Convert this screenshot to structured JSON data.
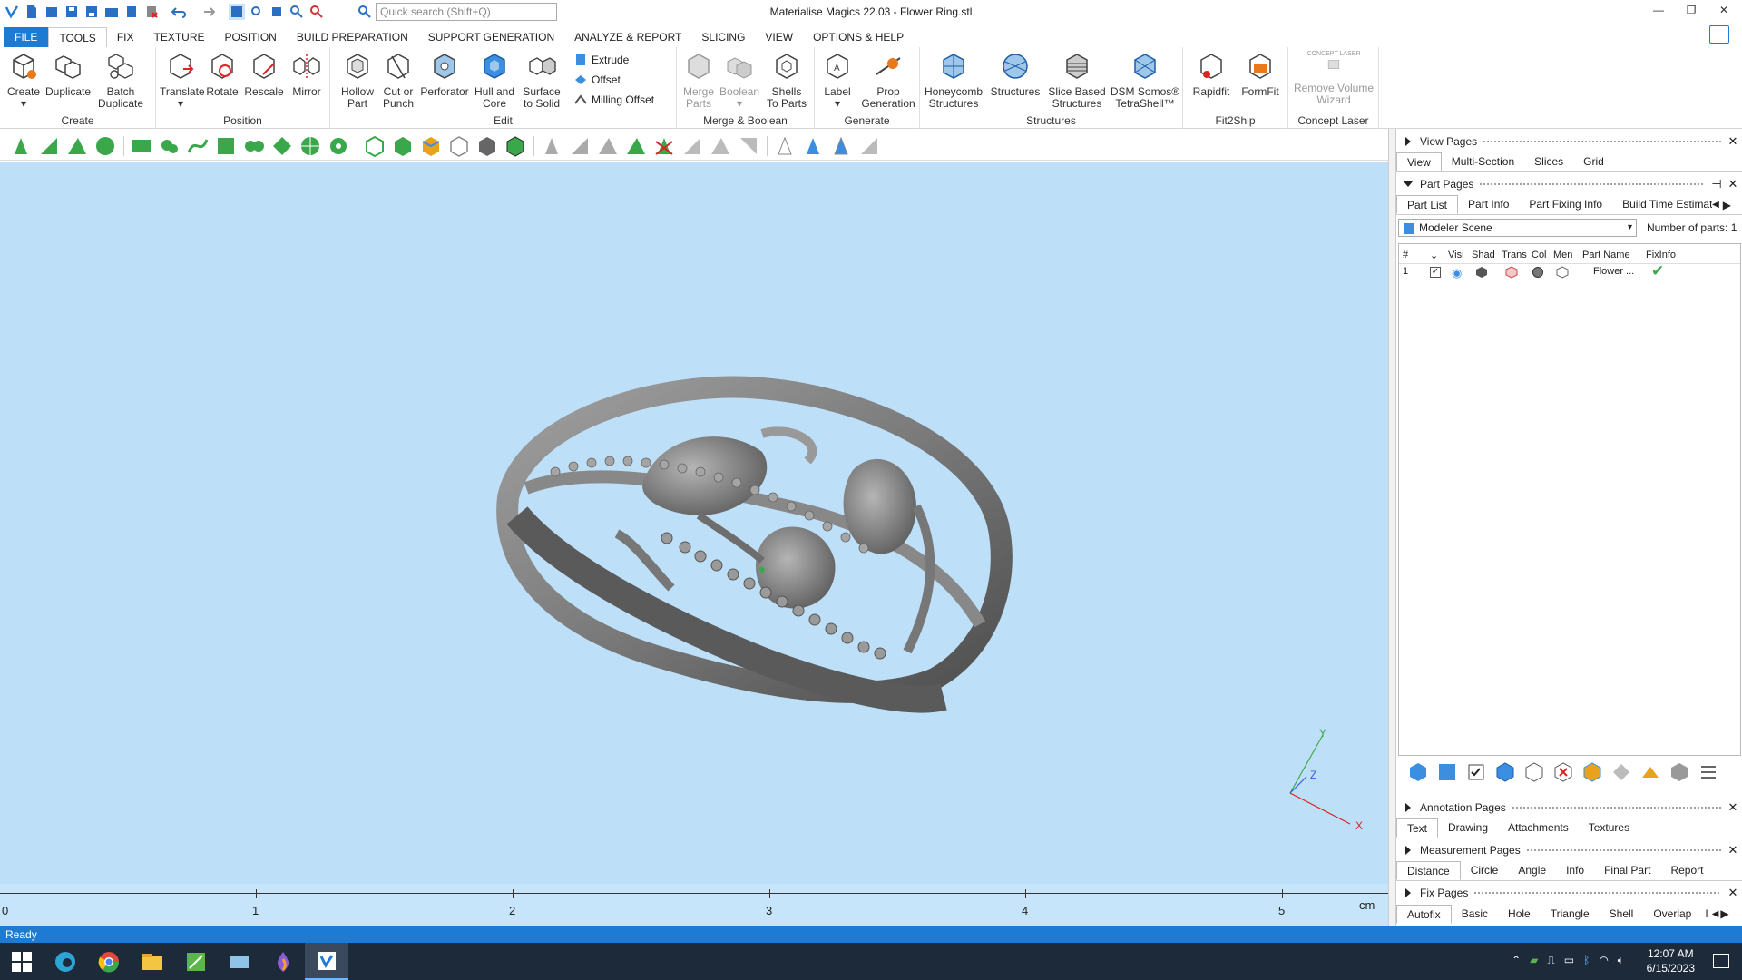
{
  "window": {
    "title": "Materialise Magics 22.03 - Flower Ring.stl",
    "search_placeholder": "Quick search (Shift+Q)"
  },
  "menu_tabs": [
    "FILE",
    "TOOLS",
    "FIX",
    "TEXTURE",
    "POSITION",
    "BUILD PREPARATION",
    "SUPPORT GENERATION",
    "ANALYZE & REPORT",
    "SLICING",
    "VIEW",
    "OPTIONS & HELP"
  ],
  "ribbon": {
    "groups": {
      "create": "Create",
      "position": "Position",
      "edit": "Edit",
      "merge": "Merge & Boolean",
      "generate": "Generate",
      "structures": "Structures",
      "fit2ship": "Fit2Ship",
      "concept": "Concept Laser"
    },
    "buttons": {
      "create": "Create",
      "duplicate": "Duplicate",
      "batch1": "Batch",
      "batch2": "Duplicate",
      "translate": "Translate",
      "rotate": "Rotate",
      "rescale": "Rescale",
      "mirror": "Mirror",
      "hollow1": "Hollow",
      "hollow2": "Part",
      "cut1": "Cut or",
      "cut2": "Punch",
      "perforator": "Perforator",
      "hull1": "Hull and",
      "hull2": "Core",
      "surface1": "Surface",
      "surface2": "to Solid",
      "extrude": "Extrude",
      "offset": "Offset",
      "milling": "Milling Offset",
      "merge1": "Merge",
      "merge2": "Parts",
      "boolean": "Boolean",
      "shells1": "Shells",
      "shells2": "To Parts",
      "label": "Label",
      "prop1": "Prop",
      "prop2": "Generation",
      "honey1": "Honeycomb",
      "honey2": "Structures",
      "structures": "Structures",
      "slice1": "Slice Based",
      "slice2": "Structures",
      "dsm1": "DSM Somos®",
      "dsm2": "TetraShell™",
      "rapidfit": "Rapidfit",
      "formfit": "FormFit",
      "remove1": "Remove Volume",
      "remove2": "Wizard",
      "concept_logo": "CONCEPT LASER"
    }
  },
  "ruler": {
    "labels": [
      "0",
      "1",
      "2",
      "3",
      "4",
      "5"
    ],
    "unit": "cm"
  },
  "axes": {
    "x": "X",
    "y": "Y",
    "z": "Z"
  },
  "panel": {
    "view_pages": "View Pages",
    "view_tabs": [
      "View",
      "Multi-Section",
      "Slices",
      "Grid"
    ],
    "part_pages": "Part Pages",
    "part_tabs": [
      "Part List",
      "Part Info",
      "Part Fixing Info",
      "Build Time Estimation"
    ],
    "scene": "Modeler Scene",
    "nparts_label": "Number of parts:",
    "nparts": "1",
    "columns": {
      "num": "#",
      "visi": "Visi",
      "shad": "Shad",
      "trans": "Trans",
      "col": "Col",
      "men": "Men",
      "name": "Part Name",
      "fix": "FixInfo"
    },
    "row": {
      "num": "1",
      "name": "Flower ..."
    },
    "annotation_pages": "Annotation Pages",
    "annotation_tabs": [
      "Text",
      "Drawing",
      "Attachments",
      "Textures"
    ],
    "measurement_pages": "Measurement Pages",
    "measurement_tabs": [
      "Distance",
      "Circle",
      "Angle",
      "Info",
      "Final Part",
      "Report"
    ],
    "fix_pages": "Fix Pages",
    "fix_tabs": [
      "Autofix",
      "Basic",
      "Hole",
      "Triangle",
      "Shell",
      "Overlap",
      "I"
    ]
  },
  "status": "Ready",
  "clock": {
    "time": "12:07 AM",
    "date": "6/15/2023"
  },
  "colors": {
    "accent": "#1e7bd4",
    "viewport": "#bedff8",
    "ring": "#8a8a8a"
  }
}
